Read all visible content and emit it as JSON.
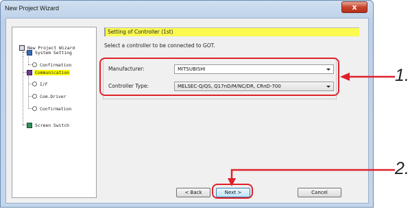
{
  "window": {
    "title": "New Project Wizard",
    "close_glyph": "x"
  },
  "tree": {
    "root": "New Project Wizard",
    "system_setting": "System Setting",
    "system_confirmation": "Confirmation",
    "communication": "Communication",
    "if": "I/F",
    "com_driver": "Com.Driver",
    "comm_confirmation": "Confirmation",
    "screen_switch": "Screen Switch",
    "selected_item": "Communication",
    "highlight_color": "#ffff00"
  },
  "main": {
    "header": "Setting of Controller (1st)",
    "instruction": "Select a controller to be connected to GOT.",
    "manufacturer": {
      "label": "Manufacturer:",
      "value": "MITSUBISHI"
    },
    "controller_type": {
      "label": "Controller Type:",
      "value": "MELSEC-Q/QS, Q17nD/M/NC/DR, CRnD-700"
    }
  },
  "buttons": {
    "back": "< Back",
    "next": "Next >",
    "cancel": "Cancel"
  },
  "callouts": {
    "one": "1.",
    "two": "2."
  },
  "colors": {
    "callout_red": "#e0202a",
    "header_yellow": "#fafa50"
  }
}
